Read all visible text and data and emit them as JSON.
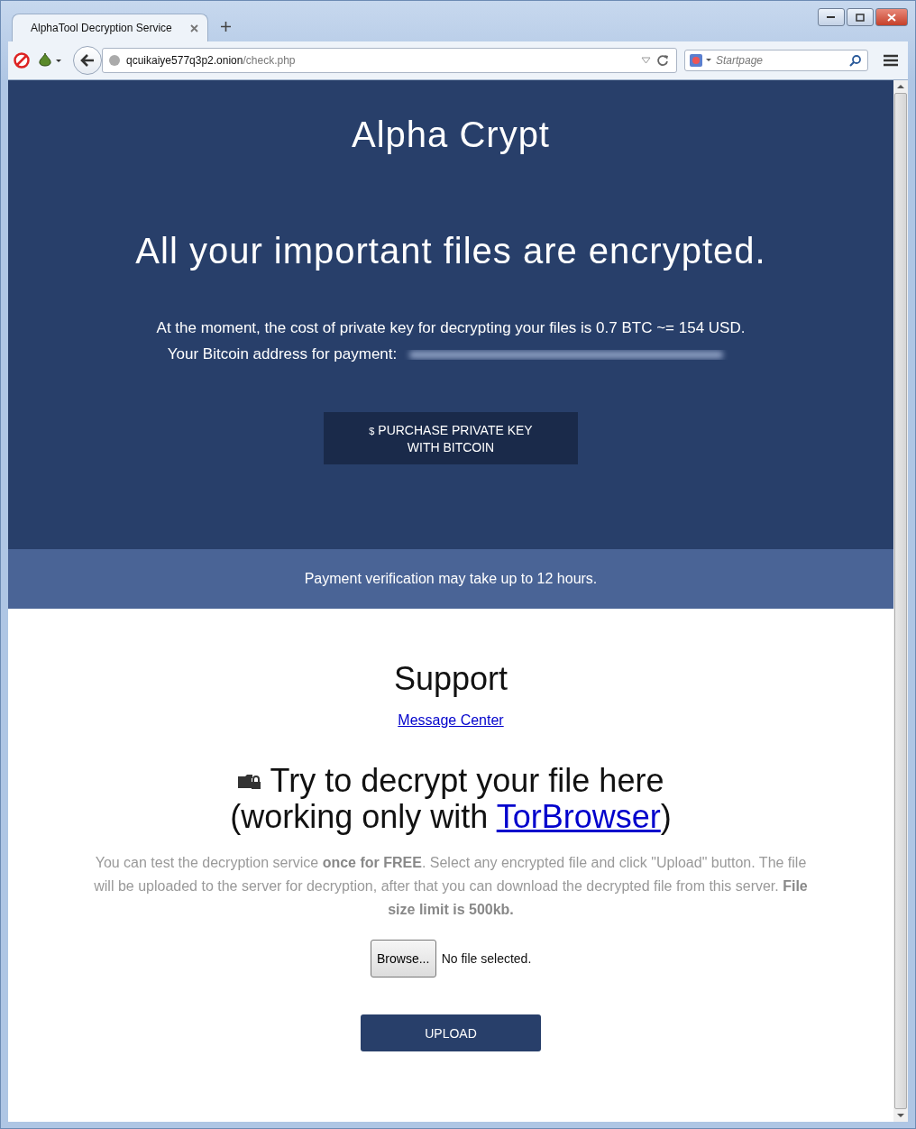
{
  "window": {
    "tab_title": "AlphaTool Decryption Service"
  },
  "address_bar": {
    "host": "qcuikaiye577q3p2.onion",
    "path": "/check.php"
  },
  "search": {
    "placeholder": "Startpage"
  },
  "header": {
    "brand": "Alpha Crypt",
    "headline": "All your important files are encrypted.",
    "cost_text": "At the moment, the cost of private key for decrypting your files is 0.7 BTC ~= 154 USD.",
    "address_label": "Your Bitcoin address for payment:",
    "purchase_button": {
      "icon": "$",
      "lines": [
        "PURCHASE PRIVATE KEY",
        "WITH BITCOIN"
      ]
    }
  },
  "notice": "Payment verification may take up to 12 hours.",
  "support": {
    "title": "Support",
    "link": "Message Center"
  },
  "decrypt": {
    "title": "Try to decrypt your file here",
    "subtitle_before": "(working only with ",
    "subtitle_link": "TorBrowser",
    "subtitle_after": ")",
    "description": "You can test the decryption service **once for FREE**. Select any encrypted file and click \"Upload\" button. The file will be uploaded to the server for decryption, after that you can download the decrypted file from this server. **File size limit is 500kb.**",
    "browse_button": "Browse...",
    "file_status": "No file selected.",
    "upload_button": "UPLOAD"
  }
}
